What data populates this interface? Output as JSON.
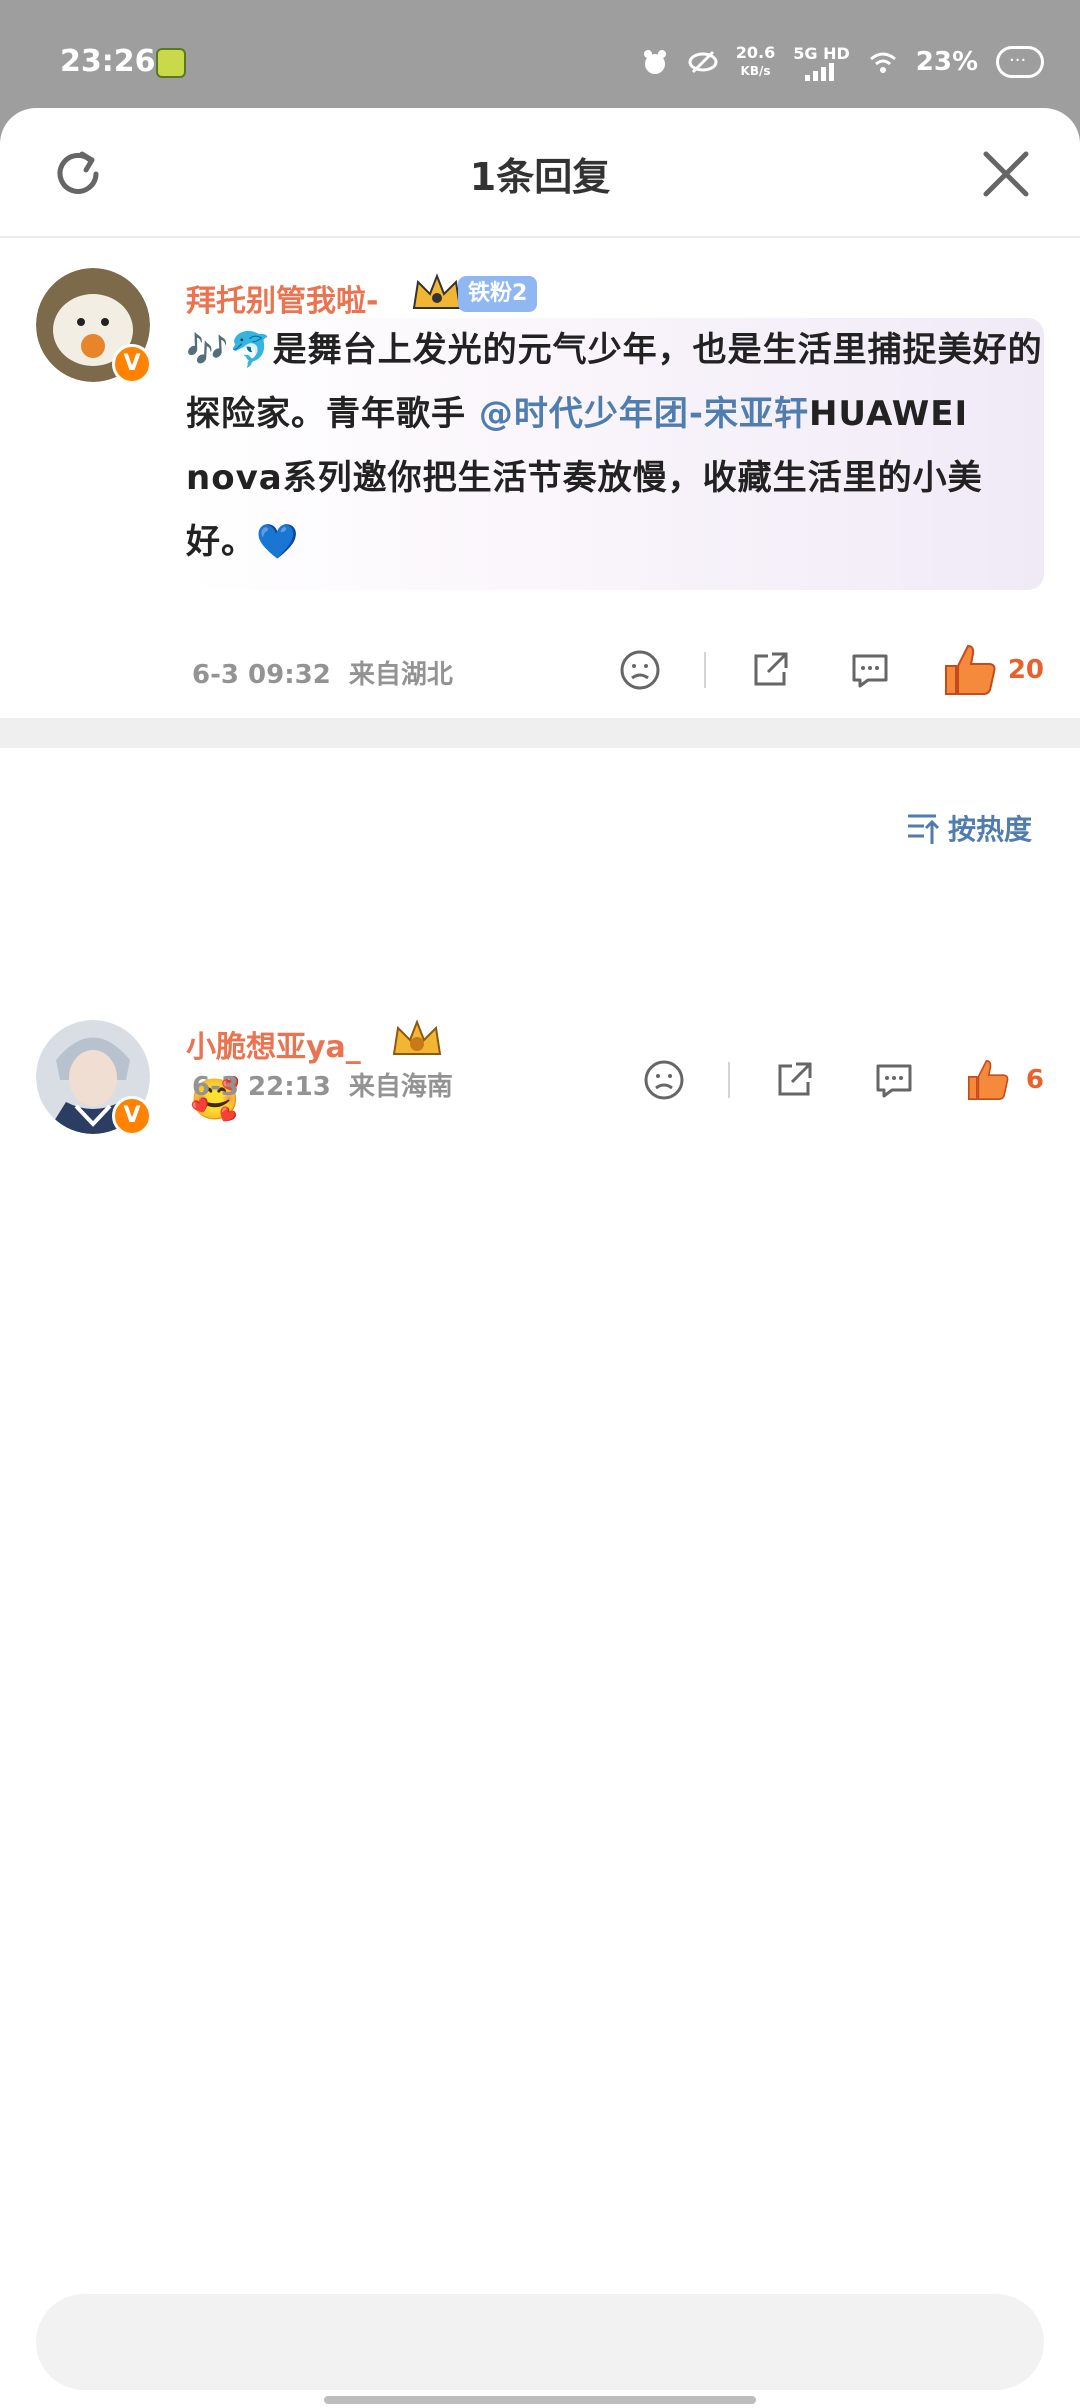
{
  "status_bar": {
    "time": "23:26",
    "net_speed_value": "20.6",
    "net_speed_unit": "KB/s",
    "signal_label": "5G HD",
    "battery": "23%"
  },
  "header": {
    "title": "1条回复",
    "refresh_icon": "refresh-icon",
    "close_icon": "close-icon"
  },
  "root_comment": {
    "username": "拜托别管我啦-",
    "fan_badge": "铁粉2",
    "text_part1": "🎶🐬是舞台上发光的元气少年，也是生活里捕捉美好的探险家。青年歌手 ",
    "mention": "@时代少年团-宋亚轩",
    "text_part2": "HUAWEI nova系列邀你把生活节奏放慢，收藏生活里的小美好。💙",
    "date": "6-3 09:32",
    "location": "来自湖北",
    "like_count": "20"
  },
  "sort": {
    "label": "按热度",
    "icon": "sort-icon"
  },
  "replies": [
    {
      "username": "小脆想亚ya_",
      "text": "🥰",
      "date": "6-3 22:13",
      "location": "来自海南",
      "like_count": "6"
    }
  ],
  "reply_input": {
    "placeholder": ""
  },
  "colors": {
    "accent_orange": "#eb7350",
    "like_orange": "#e8612c",
    "link_blue": "#507daf",
    "meta_gray": "#939393"
  }
}
